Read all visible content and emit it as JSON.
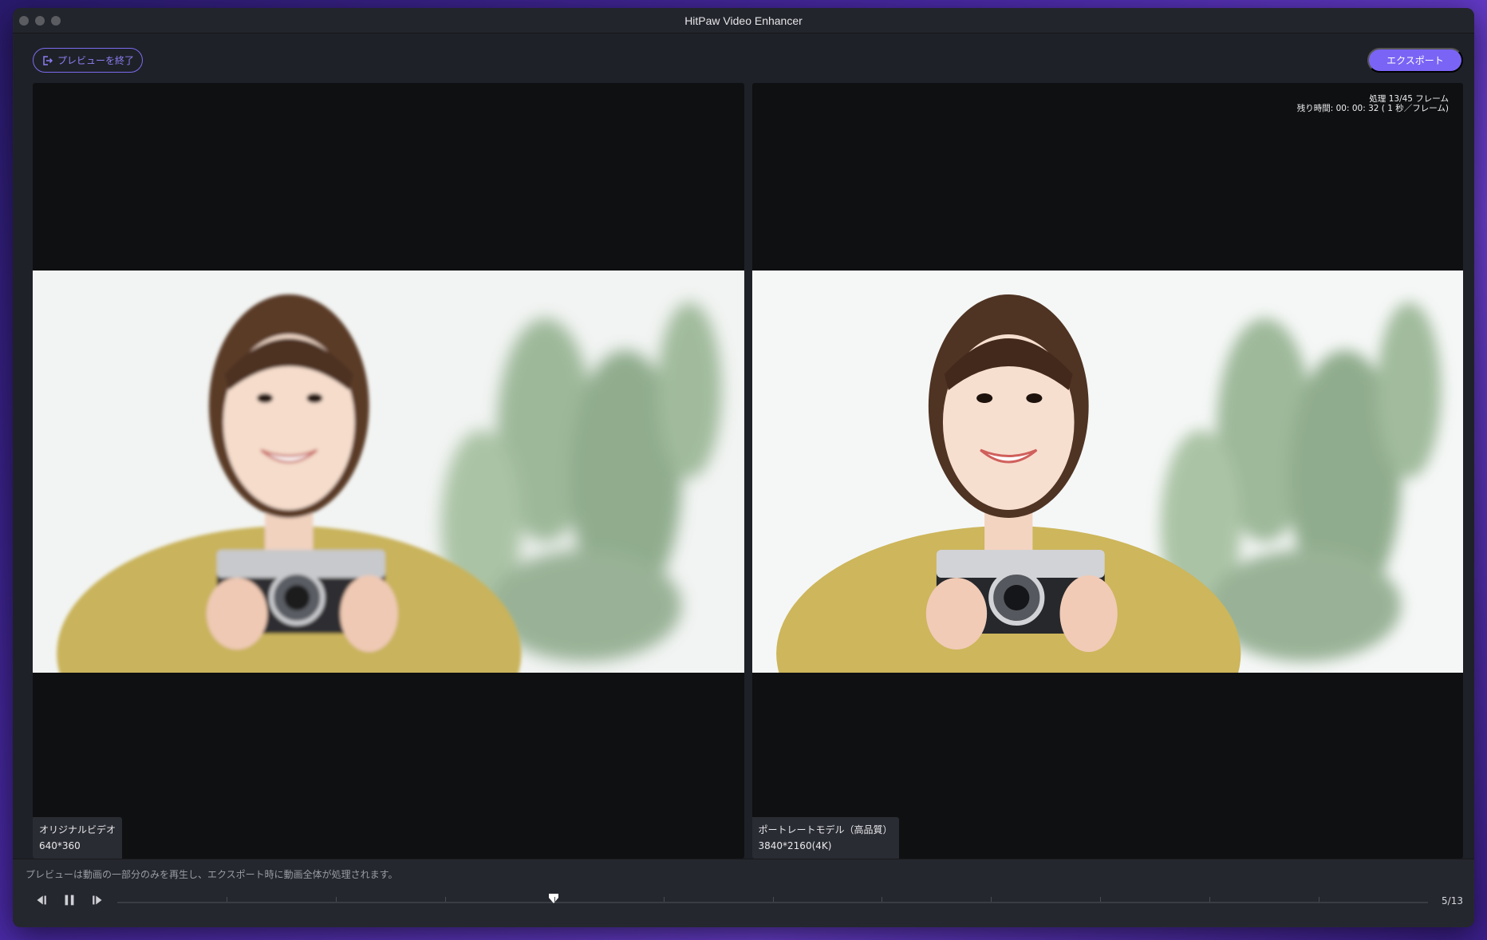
{
  "window": {
    "title": "HitPaw Video Enhancer"
  },
  "toolbar": {
    "exit_preview_label": "プレビューを終了",
    "export_label": "エクスポート"
  },
  "left_pane": {
    "label_name": "オリジナルビデオ",
    "label_resolution": "640*360"
  },
  "right_pane": {
    "label_name": "ポートレートモデル（高品質）",
    "label_resolution": "3840*2160(4K)",
    "progress_frames": "処理 13/45 フレーム",
    "remaining_time": "残り時間: 00: 00: 32 ( 1 秒／フレーム)"
  },
  "footer": {
    "note": "プレビューは動画の一部分のみを再生し、エクスポート時に動画全体が処理されます。",
    "frame_counter": "5/13",
    "playhead_position": 0.333,
    "tick_count": 12
  },
  "colors": {
    "accent": "#7a64f5",
    "window_bg": "#1f2128",
    "pane_bg": "#0f1012"
  },
  "icons": {
    "exit": "exit-icon",
    "prev": "previous-frame-icon",
    "pause": "pause-icon",
    "next": "next-frame-icon",
    "playhead": "playhead-icon"
  }
}
